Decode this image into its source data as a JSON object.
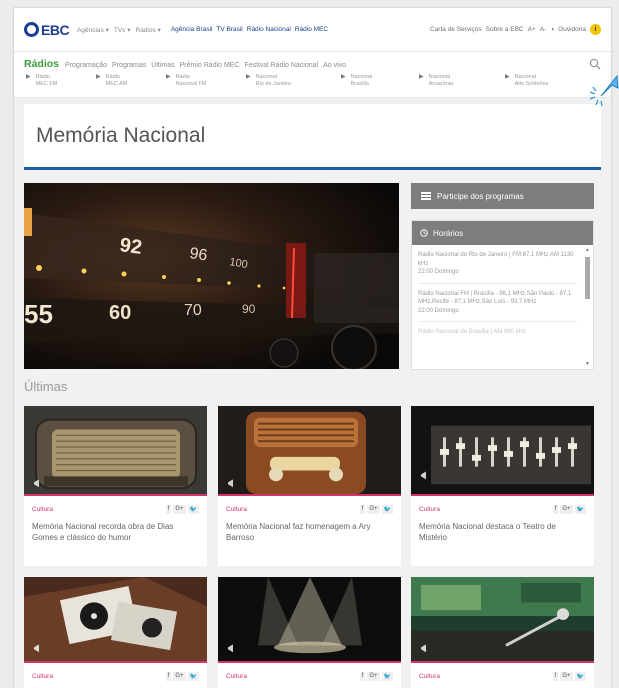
{
  "top_bar": {
    "logo_text": "EBC",
    "dropdowns": [
      "Agências ▾",
      "TVs ▾",
      "Rádios ▾"
    ],
    "links": [
      "Agência Brasil",
      "TV Brasil",
      "Rádio Nacional",
      "Rádio MEC"
    ],
    "right_links": [
      "Carta de Serviços",
      "Sobre a EBC",
      "A+",
      "A-",
      "◑",
      "Ouvidoria"
    ],
    "help_badge": "i"
  },
  "radios_nav": {
    "brand": "Rádios",
    "links": [
      "Programação",
      "Programas",
      "Últimas",
      "Prêmio Rádio MEC",
      "Festival Rádio Nacional",
      "Ao vivo"
    ],
    "stations": [
      {
        "line1": "Rádio",
        "line2": "MEC FM"
      },
      {
        "line1": "Rádio",
        "line2": "MEC AM"
      },
      {
        "line1": "Rádio",
        "line2": "Nacional FM"
      },
      {
        "line1": "Nacional",
        "line2": "Rio de Janeiro"
      },
      {
        "line1": "Nacional",
        "line2": "Brasília"
      },
      {
        "line1": "Nacional",
        "line2": "Amazônia"
      },
      {
        "line1": "Nacional",
        "line2": "Alto Solimões"
      }
    ]
  },
  "page_title": "Memória Nacional",
  "sidebar": {
    "participe_label": "Participe dos programas",
    "horarios_label": "Horários",
    "schedule": [
      {
        "text": "Rádio Nacional do Rio de Janeiro | FM 87.1 MHz,AM 1130 kHz",
        "time": "22:00 Domingo"
      },
      {
        "text": "Rádio Nacional FM | Brasília - 96,1 MHz,São Paulo - 87,1 MHz,Recife - 87,1 MHz,São Luís - 93,7 MHz",
        "time": "22:00 Domingo"
      },
      {
        "text": "Rádio Nacional de Brasília | AM 980 kHz",
        "time": ""
      }
    ]
  },
  "ultimas": {
    "heading": "Últimas",
    "share_labels": [
      "f",
      "G+",
      "🐦"
    ],
    "cards": [
      {
        "category": "Cultura",
        "headline": "Memória Nacional recorda obra de Dias Gomes e clássico do humor"
      },
      {
        "category": "Cultura",
        "headline": "Memória Nacional faz homenagem a Ary Barroso"
      },
      {
        "category": "Cultura",
        "headline": "Memória Nacional destaca o Teatro de Mistério"
      },
      {
        "category": "Cultura",
        "headline": ""
      },
      {
        "category": "Cultura",
        "headline": ""
      },
      {
        "category": "Cultura",
        "headline": ""
      }
    ]
  },
  "hero_dial_numbers": [
    "92",
    "96",
    "100",
    "55",
    "60",
    "70",
    "90"
  ],
  "colors": {
    "brand_blue": "#1b3f8e",
    "radios_green": "#3a9d3a",
    "accent_pink": "#d6336c",
    "title_underline": "#1f5da3"
  }
}
